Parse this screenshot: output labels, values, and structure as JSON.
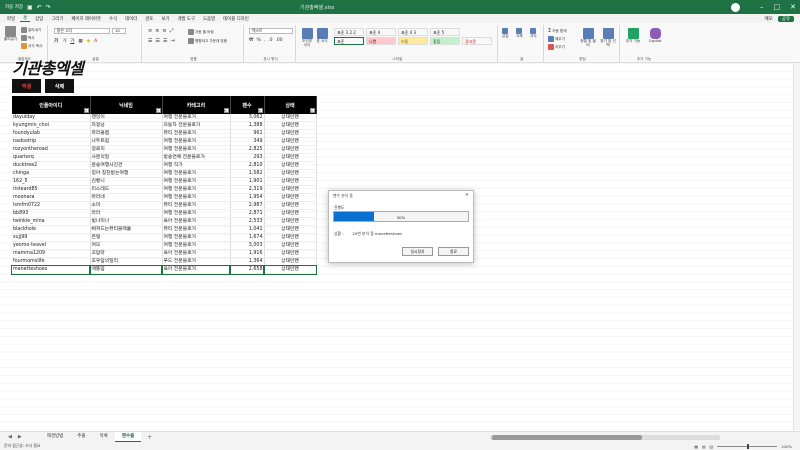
{
  "titlebar": {
    "autosave": "자동 저장",
    "filename": "기관총엑셀.xlsx"
  },
  "menu": {
    "tabs": [
      "파일",
      "홈",
      "삽입",
      "그리기",
      "페이지 레이아웃",
      "수식",
      "데이터",
      "검토",
      "보기",
      "개발 도구",
      "도움말",
      "테이블 디자인"
    ],
    "active": 1,
    "comment": "메모",
    "share": "공유"
  },
  "ribbon": {
    "clipboard": {
      "paste": "붙여넣기",
      "cut": "잘라내기",
      "copy": "복사",
      "format_painter": "서식 복사",
      "label": "클립보드"
    },
    "font": {
      "name": "맑은 고딕",
      "size": "10",
      "label": "글꼴"
    },
    "align": {
      "wrap": "자동 줄 바꿈",
      "merge": "병합하고 가운데 맞춤",
      "label": "맞춤"
    },
    "number": {
      "format": "텍스트",
      "label": "표시 형식"
    },
    "styles": {
      "cond": "조건부 서식",
      "table": "표 서식",
      "cells": [
        {
          "name": "표준 3 2 2",
          "bg": "#ffffff"
        },
        {
          "name": "표준 4",
          "bg": "#ffffff"
        },
        {
          "name": "표준 4 3",
          "bg": "#ffffff"
        },
        {
          "name": "표준 5",
          "bg": "#ffffff"
        },
        {
          "name": "표준",
          "bg": "#ffffff"
        },
        {
          "name": "나쁨",
          "bg": "#ffc7ce"
        },
        {
          "name": "보통",
          "bg": "#ffeb9c"
        },
        {
          "name": "좋음",
          "bg": "#c6efce"
        },
        {
          "name": "경고문",
          "bg": "#ffffff"
        }
      ],
      "label": "스타일"
    },
    "cells": {
      "insert": "삽입",
      "delete": "삭제",
      "format": "서식",
      "label": "셀"
    },
    "editing": {
      "autosum": "자동 합계",
      "fill": "채우기",
      "clear": "지우기",
      "sort": "정렬 및 필터",
      "find": "찾기 및 선택",
      "label": "편집"
    },
    "addins": {
      "addin": "추가 기능",
      "copilot": "Copilot",
      "label": "추가 기능"
    }
  },
  "sheet": {
    "logo": "기관총엑셀",
    "btn_excel": "엑셀",
    "btn_delete": "삭제",
    "headers": [
      "인플아이디",
      "닉네임",
      "카테고리",
      "팬수",
      "상태"
    ],
    "rows": [
      [
        "dayulday",
        "헨잉이",
        "여행 전문블로거",
        "3,062",
        "상태만팬"
      ],
      [
        "kyungmin_choi",
        "차정남",
        "자동차 전문블로거",
        "1,388",
        "상태만팬"
      ],
      [
        "foundyulab",
        "파리올랩",
        "뷰티 전문블로거",
        "961",
        "상태만팬"
      ],
      [
        "nadootrip",
        "나두트립",
        "여행 전문블로거",
        "349",
        "상태만팬"
      ],
      [
        "rozyontheroad",
        "정로지",
        "여행 전문블로거",
        "2,825",
        "상태만팬"
      ],
      [
        "quarterq",
        "사분의일",
        "방송연예 전문블로거",
        "293",
        "상태만팬"
      ],
      [
        "ducktree2",
        "윤승여행사진관",
        "여행 작가",
        "2,810",
        "상태만팬"
      ],
      [
        "chinga",
        "칭아 칭찬받는여행",
        "여행 전문블로거",
        "1,582",
        "상태만팬"
      ],
      [
        "162_5",
        "김빵니",
        "여행 전문블로거",
        "1,901",
        "상태만팬"
      ],
      [
        "risteard85",
        "리스테드",
        "여행 전문블로거",
        "2,319",
        "상태만팬"
      ],
      [
        "moonara",
        "마라네",
        "여행 전문블로거",
        "1,954",
        "상태만팬"
      ],
      [
        "lsmfm0722",
        "소미",
        "뷰티 전문블로거",
        "2,987",
        "상태만팬"
      ],
      [
        "bb893",
        "라라",
        "여행 전문블로거",
        "2,871",
        "상태만팬"
      ],
      [
        "twinkle_mina",
        "빛나미나",
        "육아 전문블로거",
        "2,533",
        "상태만팬"
      ],
      [
        "blackhole",
        "뻐져드는뷰티블랙홀",
        "뷰티 전문블로거",
        "1,041",
        "상태만팬"
      ],
      [
        "sujj99",
        "은탱",
        "여행 전문블로거",
        "1,674",
        "상태만팬"
      ],
      [
        "yeomo-teavel",
        "여모",
        "여행 전문블로거",
        "3,003",
        "상태만팬"
      ],
      [
        "mamma1209",
        "꼬맘마",
        "육아 전문블로거",
        "1,916",
        "상태만팬"
      ],
      [
        "fourmomslife",
        "포우맘의일리",
        "푸드 전문블로거",
        "1,364",
        "상태만팬"
      ],
      [
        "manetteshoes",
        "애뚱맘",
        "육아 전문블로거",
        "2,658",
        "상태만팬"
      ]
    ]
  },
  "dialog": {
    "title": "팬수 분석 중",
    "close": "×",
    "progress_label": "진행도",
    "progress": 0.3,
    "progress_text": "30%",
    "status_label": "상황 :",
    "status_text": "20번 분석 중 manetteshoes",
    "pause": "일시정지",
    "exit": "종료"
  },
  "tabs": {
    "items": [
      "제경방법",
      "추출",
      "목록",
      "팬수출"
    ],
    "active": 3,
    "add": "+"
  },
  "status": {
    "left": "준비   접근성: 조사 필요",
    "zoom": "100%"
  }
}
